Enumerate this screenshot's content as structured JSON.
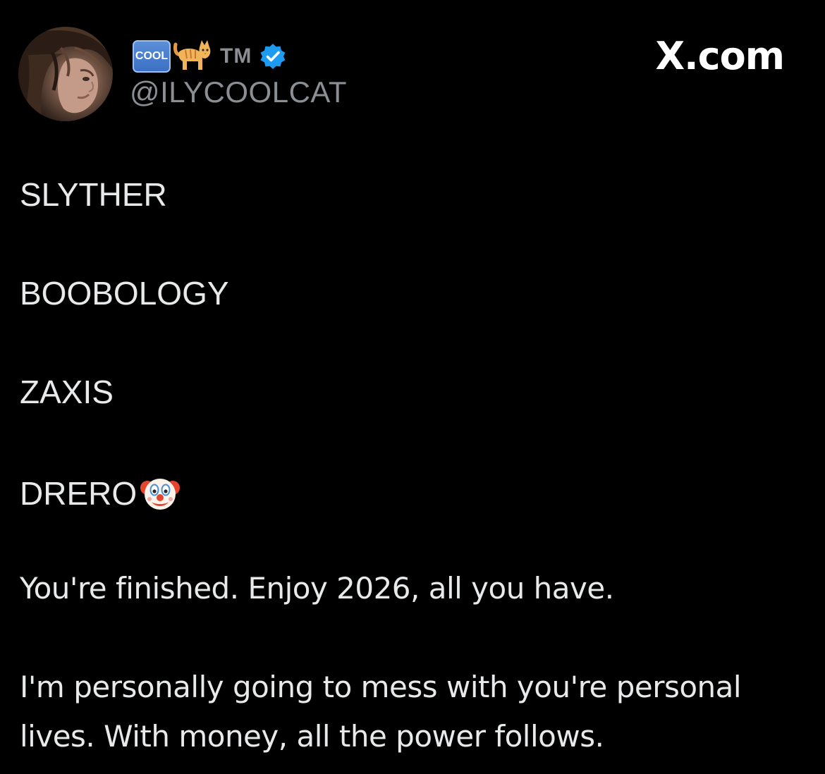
{
  "header": {
    "display_name_badge": "COOL",
    "display_name_emoji_icon": "cat-icon",
    "display_name_suffix": "TM",
    "verified_icon": "verified-badge-icon",
    "handle": "@ILYCOOLCAT",
    "site": "X.com",
    "avatar": "profile-photo"
  },
  "post": {
    "line1": "SLYTHER",
    "line2": "BOOBOLOGY",
    "line3": "ZAXIS",
    "line4": "DRERO",
    "line4_emoji_icon": "clown-face-icon",
    "line5": "You're finished. Enjoy 2026, all you have.",
    "line6a": "I'm personally going to mess with you're personal",
    "line6b": "lives. With money, all the power follows."
  },
  "colors": {
    "background": "#000000",
    "text_primary": "#e7e9ea",
    "text_secondary": "#8b8f94",
    "verified_blue": "#1d9bf0"
  }
}
